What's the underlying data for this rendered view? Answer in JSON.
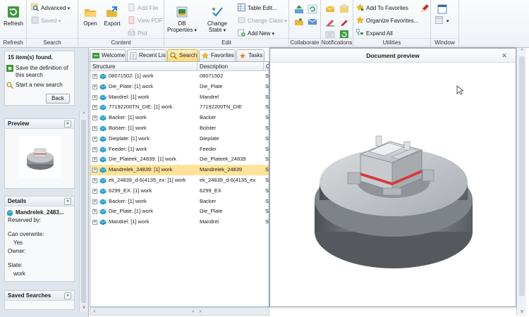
{
  "ribbon": {
    "groups": {
      "refresh": "Refresh",
      "search": "Search",
      "content": "Content",
      "edit": "Edit",
      "collaborate": "Collaborate",
      "notifications": "Notifications",
      "utilities": "Utilities",
      "window": "Window"
    },
    "refresh_label": "Refresh",
    "advanced_label": "Advanced",
    "saved_label": "Saved",
    "open_label": "Open",
    "export_label": "Export",
    "add_file_label": "Add File",
    "view_pdf_label": "View PDF",
    "plot_label": "Plot",
    "db_properties_label": "DB Properties",
    "change_state_label": "Change State",
    "table_edit_label": "Table Edit...",
    "change_class_label": "Change Class",
    "add_new_label": "Add New",
    "add_to_favorites_label": "Add To Favorites",
    "organize_favorites_label": "Organize Favorites...",
    "expand_all_label": "Expand All"
  },
  "leftpanel": {
    "results_found": "15 item(s) found.",
    "save_definition": "Save the definition of this search",
    "start_new_search": "Start a new search",
    "back_label": "Back",
    "preview_header": "Preview",
    "details_header": "Details",
    "details_item_name": "Mandrelek_2483...",
    "reserved_by_label": "Reserved by:",
    "can_overwrite_label": "Can overwrite:",
    "can_overwrite_value": "Yes",
    "owner_label": "Owner:",
    "state_label": "State:",
    "state_value": "work",
    "saved_searches_header": "Saved Searches"
  },
  "tabs": [
    {
      "label": "Welcome"
    },
    {
      "label": "Recent List"
    },
    {
      "label": "Search"
    },
    {
      "label": "Favorites"
    },
    {
      "label": "Tasks"
    }
  ],
  "grid": {
    "columns": [
      "Structure",
      "Description",
      "O"
    ],
    "rows": [
      {
        "structure": "08071502: [1] work",
        "description": "08071502",
        "o": "Se"
      },
      {
        "structure": "Die_Plate: [1] work",
        "description": "Die_Plate",
        "o": "Se"
      },
      {
        "structure": "Mandrel: [1] work",
        "description": "Mandrel",
        "o": "Se"
      },
      {
        "structure": "77192200TN_DIE: [1] work",
        "description": "77192200TN_DIE",
        "o": "Se"
      },
      {
        "structure": "Backer: [1] work",
        "description": "Backer",
        "o": "Se"
      },
      {
        "structure": "Bolster: [1] work",
        "description": "Bolster",
        "o": "Se"
      },
      {
        "structure": "Dieplate: [1] work",
        "description": "Dieplate",
        "o": "Se"
      },
      {
        "structure": "Feeder: [1] work",
        "description": "Feeder",
        "o": "Se"
      },
      {
        "structure": "Die_Plateek_24839: [1] work",
        "description": "Die_Plateek_24839",
        "o": "Se"
      },
      {
        "structure": "Mandrelek_24839: [1] work",
        "description": "Mandrelek_24839",
        "o": "Se"
      },
      {
        "structure": "ek_24839_d-6(4135_ex: [1] work",
        "description": "ek_24839_d-6(4135_ex",
        "o": "Se"
      },
      {
        "structure": "6299_EX: [1] work",
        "description": "6299_EX",
        "o": "Se"
      },
      {
        "structure": "Backer: [1] work",
        "description": "Backer",
        "o": "Se"
      },
      {
        "structure": "Die_Plate: [1] work",
        "description": "Die_Plate",
        "o": "Se"
      },
      {
        "structure": "Mandrel: [1] work",
        "description": "Mandrel",
        "o": "Se"
      }
    ],
    "selected_index": 9
  },
  "preview": {
    "title": "Document preview"
  }
}
